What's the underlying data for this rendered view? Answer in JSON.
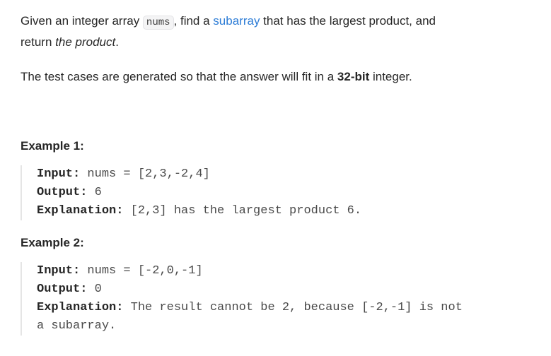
{
  "description": {
    "p1_part1": "Given an integer array ",
    "p1_code": "nums",
    "p1_part2": ", find a ",
    "p1_link": "subarray",
    "p1_part3": " that has the largest product, and",
    "p1_part4": "return ",
    "p1_italic": "the product",
    "p1_part5": ".",
    "p2_part1": "The test cases are generated so that the answer will fit in a ",
    "p2_bold": "32-bit",
    "p2_part2": " integer."
  },
  "examples": [
    {
      "heading": "Example 1:",
      "input_label": "Input:",
      "input_value": " nums = [2,3,-2,4]",
      "output_label": "Output:",
      "output_value": " 6",
      "explanation_label": "Explanation:",
      "explanation_line1": " [2,3] has the largest product 6."
    },
    {
      "heading": "Example 2:",
      "input_label": "Input:",
      "input_value": " nums = [-2,0,-1]",
      "output_label": "Output:",
      "output_value": " 0",
      "explanation_label": "Explanation:",
      "explanation_line1": " The result cannot be 2, because [-2,-1] is not",
      "explanation_line2": "a subarray."
    }
  ],
  "colors": {
    "link": "#2c7cd6",
    "text": "#262626",
    "code_background": "#f4f4f5",
    "block_border": "#e5e5e5"
  }
}
